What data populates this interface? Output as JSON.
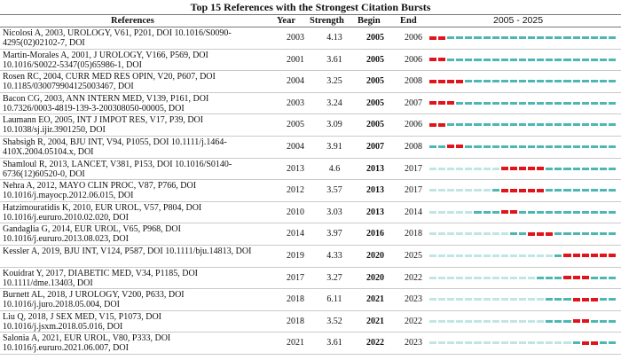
{
  "title": "Top 15 References with the Strongest Citation Bursts",
  "headers": {
    "references": "References",
    "year": "Year",
    "strength": "Strength",
    "begin": "Begin",
    "end": "End",
    "range": "2005 - 2025"
  },
  "colors": {
    "burst": "#e0141b",
    "cited": "#4db8b3",
    "not_published": "#bfe6e4"
  },
  "timeline": {
    "start": 2005,
    "end": 2025
  },
  "rows": [
    {
      "ref_line1": "Nicolosi A, 2003, UROLOGY, V61, P201, DOI 10.1016/S0090-",
      "ref_line2": "4295(02)02102-7, DOI",
      "year": 2003,
      "strength": "4.13",
      "begin": 2005,
      "end": 2006
    },
    {
      "ref_line1": "Martin-Morales A, 2001, J UROLOGY, V166, P569, DOI",
      "ref_line2": "10.1016/S0022-5347(05)65986-1, DOI",
      "year": 2001,
      "strength": "3.61",
      "begin": 2005,
      "end": 2006
    },
    {
      "ref_line1": "Rosen RC, 2004, CURR MED RES OPIN, V20, P607, DOI",
      "ref_line2": "10.1185/030079904125003467, DOI",
      "year": 2004,
      "strength": "3.25",
      "begin": 2005,
      "end": 2008
    },
    {
      "ref_line1": "Bacon CG, 2003, ANN INTERN MED, V139, P161, DOI",
      "ref_line2": "10.7326/0003-4819-139-3-200308050-00005, DOI",
      "year": 2003,
      "strength": "3.24",
      "begin": 2005,
      "end": 2007
    },
    {
      "ref_line1": "Laumann EO, 2005, INT J IMPOT RES, V17, P39, DOI",
      "ref_line2": "10.1038/sj.ijir.3901250, DOI",
      "year": 2005,
      "strength": "3.09",
      "begin": 2005,
      "end": 2006
    },
    {
      "ref_line1": "Shabsigh R, 2004, BJU INT, V94, P1055, DOI 10.1111/j.1464-",
      "ref_line2": "410X.2004.05104.x, DOI",
      "year": 2004,
      "strength": "3.91",
      "begin": 2007,
      "end": 2008
    },
    {
      "ref_line1": "Shamloul R, 2013, LANCET, V381, P153, DOI 10.1016/S0140-",
      "ref_line2": "6736(12)60520-0, DOI",
      "year": 2013,
      "strength": "4.6",
      "begin": 2013,
      "end": 2017
    },
    {
      "ref_line1": "Nehra A, 2012, MAYO CLIN PROC, V87, P766, DOI",
      "ref_line2": "10.1016/j.mayocp.2012.06.015, DOI",
      "year": 2012,
      "strength": "3.57",
      "begin": 2013,
      "end": 2017
    },
    {
      "ref_line1": "Hatzimouratidis K, 2010, EUR UROL, V57, P804, DOI",
      "ref_line2": "10.1016/j.eururo.2010.02.020, DOI",
      "year": 2010,
      "strength": "3.03",
      "begin": 2013,
      "end": 2014
    },
    {
      "ref_line1": "Gandaglia G, 2014, EUR UROL, V65, P968, DOI",
      "ref_line2": "10.1016/j.eururo.2013.08.023, DOI",
      "year": 2014,
      "strength": "3.97",
      "begin": 2016,
      "end": 2018
    },
    {
      "ref_line1": "Kessler A, 2019, BJU INT, V124, P587, DOI 10.1111/bju.14813, DOI",
      "ref_line2": "",
      "year": 2019,
      "strength": "4.33",
      "begin": 2020,
      "end": 2025
    },
    {
      "ref_line1": "Kouidrat Y, 2017, DIABETIC MED, V34, P1185, DOI",
      "ref_line2": "10.1111/dme.13403, DOI",
      "year": 2017,
      "strength": "3.27",
      "begin": 2020,
      "end": 2022
    },
    {
      "ref_line1": "Burnett AL, 2018, J UROLOGY, V200, P633, DOI",
      "ref_line2": "10.1016/j.juro.2018.05.004, DOI",
      "year": 2018,
      "strength": "6.11",
      "begin": 2021,
      "end": 2023
    },
    {
      "ref_line1": "Liu Q, 2018, J SEX MED, V15, P1073, DOI",
      "ref_line2": "10.1016/j.jsxm.2018.05.016, DOI",
      "year": 2018,
      "strength": "3.52",
      "begin": 2021,
      "end": 2022
    },
    {
      "ref_line1": "Salonia A, 2021, EUR UROL, V80, P333, DOI",
      "ref_line2": "10.1016/j.eururo.2021.06.007, DOI",
      "year": 2021,
      "strength": "3.61",
      "begin": 2022,
      "end": 2023
    }
  ]
}
